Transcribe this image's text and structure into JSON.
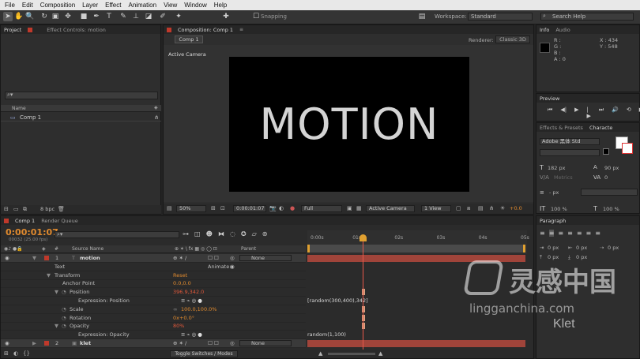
{
  "menu": [
    "File",
    "Edit",
    "Composition",
    "Layer",
    "Effect",
    "Animation",
    "View",
    "Window",
    "Help"
  ],
  "toolbar": {
    "snapping_label": "Snapping",
    "workspace_label": "Workspace:",
    "workspace_value": "Standard",
    "search_placeholder": "Search Help"
  },
  "project_panel": {
    "tab": "Project",
    "tab2": "Effect Controls: motion",
    "col_name": "Name",
    "item": "Comp 1",
    "bpc": "8 bpc"
  },
  "comp_panel": {
    "tab": "Composition: Comp 1",
    "subtab": "Comp 1",
    "renderer_label": "Renderer:",
    "renderer_value": "Classic 3D",
    "camera_label": "Active Camera",
    "viewer_text": "MOTION",
    "zoom": "50%",
    "timecode": "0:00:01:07",
    "resolution": "Full",
    "view_camera": "Active Camera",
    "views": "1 View",
    "exposure": "+0.0"
  },
  "info_panel": {
    "tab": "Info",
    "tab2": "Audio",
    "r": "R :",
    "g": "G :",
    "b": "B :",
    "a": "A : 0",
    "x": "X : 434",
    "y": "Y : 548"
  },
  "preview_panel": {
    "tab": "Preview"
  },
  "effects_panel": {
    "tab": "Effects & Presets",
    "tab2": "Characte"
  },
  "character_panel": {
    "font": "Adobe 黑体 Std",
    "size": "182 px",
    "leading": "90 px",
    "tracking_label": "Metrics",
    "kern": "0",
    "px_value": "- px",
    "scale_v": "100 %",
    "scale_h": "100 %"
  },
  "paragraph_panel": {
    "tab": "Paragraph",
    "indent1": "0 px",
    "indent2": "0 px",
    "indent3": "0 px",
    "indent4": "0 px",
    "indent5": "0 px"
  },
  "timeline": {
    "tab": "Comp 1",
    "tab2": "Render Queue",
    "timecode": "0:00:01:07",
    "frame_info": "00032 (25.00 fps)",
    "search_placeholder": "",
    "col_num": "#",
    "col_source": "Source Name",
    "col_parent": "Parent",
    "ruler": [
      "0:00s",
      "01s",
      "02s",
      "03s",
      "04s",
      "05s"
    ],
    "layers": [
      {
        "num": "1",
        "name": "motion",
        "parent": "None"
      },
      {
        "num": "2",
        "name": "klet",
        "parent": "None"
      }
    ],
    "props": {
      "text": "Text",
      "animate": "Animate:",
      "transform": "Transform",
      "reset": "Reset",
      "anchor": "Anchor Point",
      "anchor_val": "0.0,0.0",
      "position": "Position",
      "position_val": "396.9,342.0",
      "expr_position": "Expression: Position",
      "expr_position_code": "[random(300,400),342]",
      "scale": "Scale",
      "scale_val": "100.0,100.0%",
      "rotation": "Rotation",
      "rotation_val": "0x+0.0°",
      "opacity": "Opacity",
      "opacity_val": "80%",
      "expr_opacity": "Expression: Opacity",
      "expr_opacity_code": "random(1,100)"
    },
    "toggle_label": "Toggle Switches / Modes",
    "playhead_frac": 0.255
  },
  "watermark": {
    "cn": "灵感中国",
    "url": "lingganchina.com",
    "brand": "Klet"
  },
  "colors": {
    "accent": "#e08a2e",
    "layer_bar": "#a0443a",
    "playhead": "#e8584a"
  }
}
